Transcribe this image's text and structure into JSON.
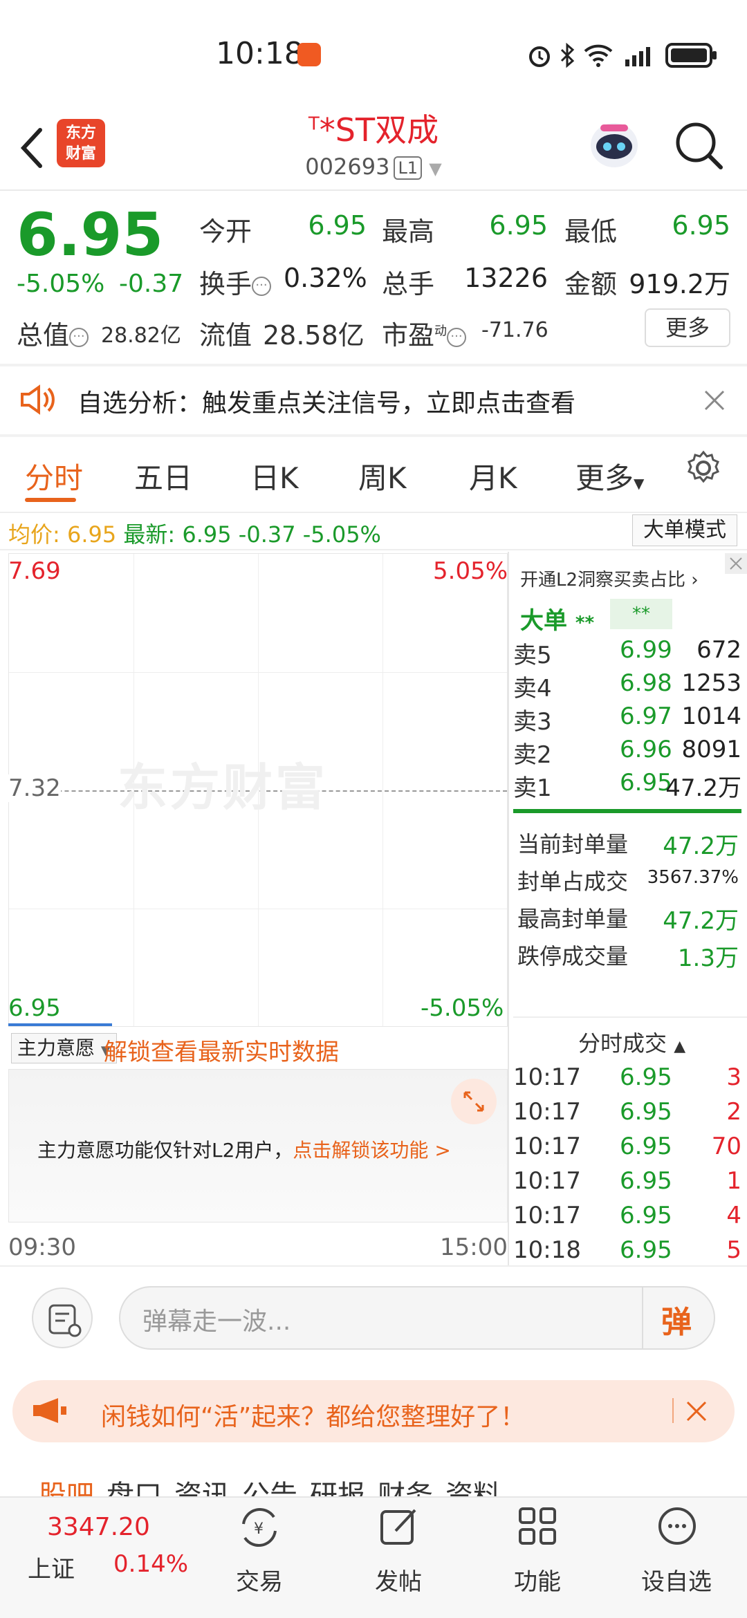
{
  "status_bar": {
    "time": "10:18"
  },
  "header": {
    "logo_text_1": "东方",
    "logo_text_2": "财富",
    "stock_prefix": "T",
    "stock_name": "*ST双成",
    "stock_code": "002693",
    "level_badge": "L1"
  },
  "quote": {
    "price": "6.95",
    "change_pct": "-5.05%",
    "change": "-0.37",
    "open_label": "今开",
    "open": "6.95",
    "high_label": "最高",
    "high": "6.95",
    "low_label": "最低",
    "low": "6.95",
    "turnover_label": "换手",
    "turnover": "0.32%",
    "volume_label": "总手",
    "volume": "13226",
    "amount_label": "金额",
    "amount": "919.2万",
    "total_mv_label": "总值",
    "total_mv": "28.82亿",
    "float_mv_label": "流值",
    "float_mv": "28.58亿",
    "pe_label": "市盈",
    "pe_sup": "动",
    "pe": "-71.76",
    "more": "更多"
  },
  "notice": {
    "text": "自选分析：触发重点关注信号，立即点击查看"
  },
  "tabs": [
    "分时",
    "五日",
    "日K",
    "周K",
    "月K",
    "更多"
  ],
  "avg_line": {
    "avg_label": "均价:",
    "avg": "6.95",
    "latest_label": "最新:",
    "latest": "6.95",
    "latest_chg": "-0.37",
    "latest_pct": "-5.05%",
    "big_order_mode": "大单模式"
  },
  "chart": {
    "y_top": "7.69",
    "y_mid": "7.32",
    "y_bottom": "6.95",
    "pct_top": "5.05%",
    "pct_bottom": "-5.05%",
    "x_start": "09:30",
    "x_end": "15:00",
    "watermark": "东方财富",
    "main_force_label": "主力意愿",
    "unlock_text": "解锁查看最新实时数据",
    "l2_notice": "主力意愿功能仅针对L2用户，",
    "l2_link": "点击解锁该功能 >"
  },
  "orderbook": {
    "l2_banner": "开通L2洞察买卖占比",
    "big_order_label": "大单",
    "big_order_val": "**",
    "big_order_val2": "**",
    "asks": [
      {
        "label": "卖5",
        "price": "6.99",
        "vol": "672"
      },
      {
        "label": "卖4",
        "price": "6.98",
        "vol": "1253"
      },
      {
        "label": "卖3",
        "price": "6.97",
        "vol": "1014"
      },
      {
        "label": "卖2",
        "price": "6.96",
        "vol": "8091"
      },
      {
        "label": "卖1",
        "price": "6.95",
        "vol": "47.2万"
      }
    ],
    "stats": [
      {
        "label": "当前封单量",
        "val": "47.2万"
      },
      {
        "label": "封单占成交",
        "val": "3567.37%"
      },
      {
        "label": "最高封单量",
        "val": "47.2万"
      },
      {
        "label": "跌停成交量",
        "val": "1.3万"
      }
    ],
    "ticks_title": "分时成交",
    "ticks": [
      {
        "time": "10:17",
        "price": "6.95",
        "vol": "3"
      },
      {
        "time": "10:17",
        "price": "6.95",
        "vol": "2"
      },
      {
        "time": "10:17",
        "price": "6.95",
        "vol": "70"
      },
      {
        "time": "10:17",
        "price": "6.95",
        "vol": "1"
      },
      {
        "time": "10:17",
        "price": "6.95",
        "vol": "4"
      },
      {
        "time": "10:18",
        "price": "6.95",
        "vol": "5"
      }
    ]
  },
  "danmu": {
    "placeholder": "弹幕走一波...",
    "send": "弹"
  },
  "promo": {
    "text": "闲钱如何“活”起来？都给您整理好了！"
  },
  "section_tabs": [
    "股吧",
    "盘口",
    "资讯",
    "公告",
    "研报",
    "财务",
    "资料"
  ],
  "bottom_nav": {
    "index_value": "3347.20",
    "index_name": "上证",
    "index_pct": "0.14%",
    "trade": "交易",
    "post": "发帖",
    "func": "功能",
    "watchlist": "设自选"
  }
}
